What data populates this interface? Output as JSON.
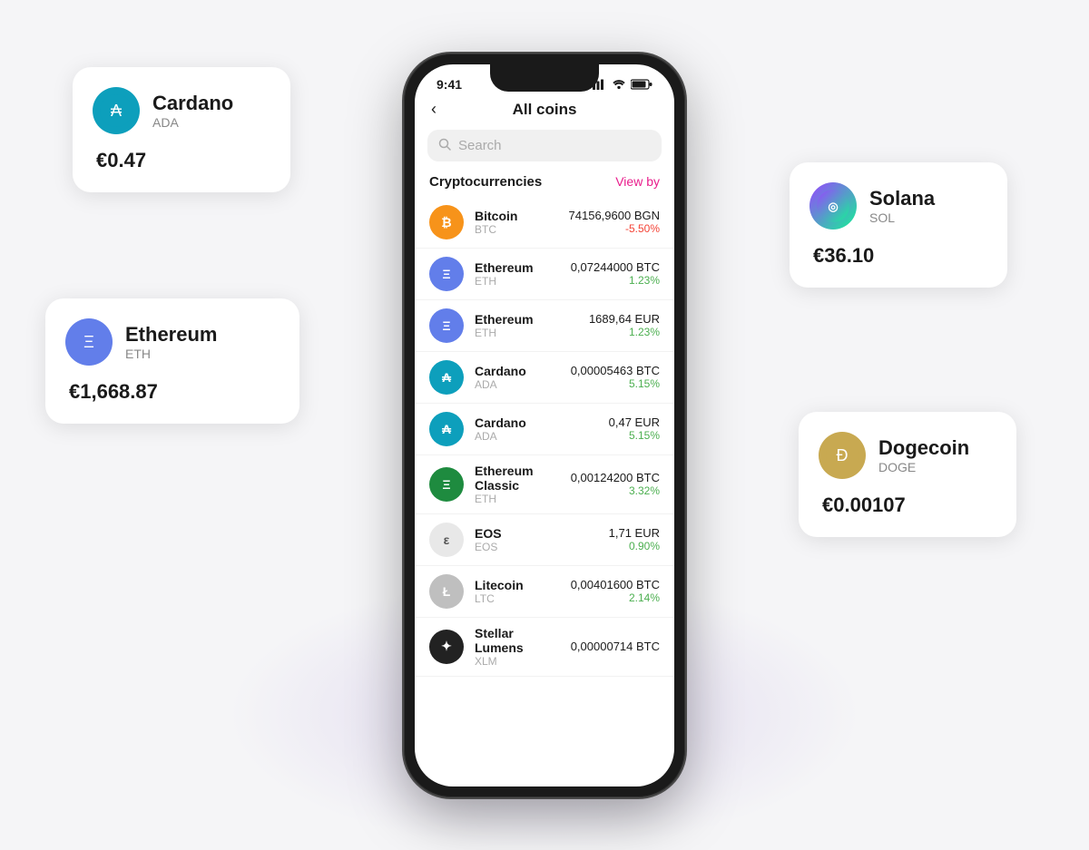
{
  "cards": {
    "cardano": {
      "name": "Cardano",
      "symbol": "ADA",
      "price": "€0.47",
      "logoColor": "#0d9fbc",
      "logoText": "₳"
    },
    "ethereum": {
      "name": "Ethereum",
      "symbol": "ETH",
      "price": "€1,668.87",
      "logoColor": "#627eea",
      "logoText": "Ξ"
    },
    "solana": {
      "name": "Solana",
      "symbol": "SOL",
      "price": "€36.10",
      "logoText": "◎"
    },
    "dogecoin": {
      "name": "Dogecoin",
      "symbol": "DOGE",
      "price": "€0.00107",
      "logoText": "Ð"
    }
  },
  "phone": {
    "statusBar": {
      "time": "9:41",
      "icons": "▐ ⊙ ▮"
    },
    "nav": {
      "backIcon": "‹",
      "title": "All coins"
    },
    "search": {
      "placeholder": "Search",
      "icon": "🔍"
    },
    "section": {
      "title": "Cryptocurrencies",
      "viewBy": "View by"
    },
    "coins": [
      {
        "name": "Bitcoin",
        "symbol": "BTC",
        "amount": "74156,9600 BGN",
        "change": "-5.50%",
        "changeType": "negative",
        "logoClass": "logo-btc",
        "logoText": "₿"
      },
      {
        "name": "Ethereum",
        "symbol": "ETH",
        "amount": "0,07244000 BTC",
        "change": "1.23%",
        "changeType": "positive",
        "logoClass": "logo-eth",
        "logoText": "Ξ"
      },
      {
        "name": "Ethereum",
        "symbol": "ETH",
        "amount": "1689,64 EUR",
        "change": "1.23%",
        "changeType": "positive",
        "logoClass": "logo-eth",
        "logoText": "Ξ"
      },
      {
        "name": "Cardano",
        "symbol": "ADA",
        "amount": "0,00005463 BTC",
        "change": "5.15%",
        "changeType": "positive",
        "logoClass": "logo-ada",
        "logoText": "₳"
      },
      {
        "name": "Cardano",
        "symbol": "ADA",
        "amount": "0,47 EUR",
        "change": "5.15%",
        "changeType": "positive",
        "logoClass": "logo-ada",
        "logoText": "₳"
      },
      {
        "name": "Ethereum Classic",
        "symbol": "ETH",
        "amount": "0,00124200 BTC",
        "change": "3.32%",
        "changeType": "positive",
        "logoClass": "logo-etc",
        "logoText": "Ξ"
      },
      {
        "name": "EOS",
        "symbol": "EOS",
        "amount": "1,71 EUR",
        "change": "0.90%",
        "changeType": "positive",
        "logoClass": "logo-eos",
        "logoText": "ε"
      },
      {
        "name": "Litecoin",
        "symbol": "LTC",
        "amount": "0,00401600 BTC",
        "change": "2.14%",
        "changeType": "positive",
        "logoClass": "logo-ltc",
        "logoText": "Ł"
      },
      {
        "name": "Stellar Lumens",
        "symbol": "XLM",
        "amount": "0,00000714 BTC",
        "change": "",
        "changeType": "positive",
        "logoClass": "logo-xlm",
        "logoText": "✦"
      }
    ]
  }
}
